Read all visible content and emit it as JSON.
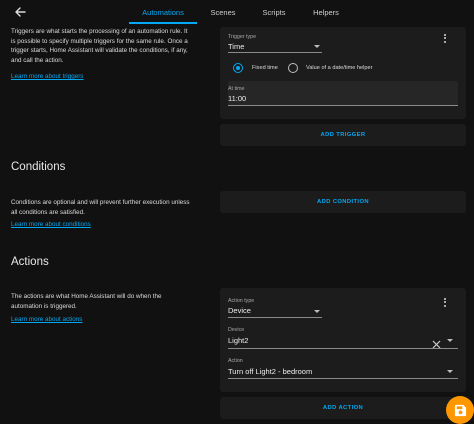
{
  "nav": {
    "tabs": [
      {
        "label": "Automations"
      },
      {
        "label": "Scenes"
      },
      {
        "label": "Scripts"
      },
      {
        "label": "Helpers"
      }
    ],
    "active_tab": "Automations"
  },
  "triggers": {
    "description_lines": [
      "Triggers are what starts the processing of an automation rule. It",
      "is possible to specify multiple triggers for the same rule. Once a",
      "trigger starts, Home Assistant will validate the conditions, if any,",
      "and call the action."
    ],
    "learn_more": "Learn more about triggers",
    "card": {
      "type_label": "Trigger type",
      "type_value": "Time",
      "radio_fixed": "Fixed time",
      "radio_helper": "Value of a date/time helper",
      "at_label": "At time",
      "at_value": "11:00"
    },
    "add_button": "ADD TRIGGER"
  },
  "conditions": {
    "title": "Conditions",
    "description_lines": [
      "Conditions are optional and will prevent further execution unless",
      "all conditions are satisfied."
    ],
    "learn_more": "Learn more about conditions",
    "add_button": "ADD CONDITION"
  },
  "actions": {
    "title": "Actions",
    "description_lines": [
      "The actions are what Home Assistant will do when the",
      "automation is triggered."
    ],
    "learn_more": "Learn more about actions",
    "card": {
      "type_label": "Action type",
      "type_value": "Device",
      "device_label": "Device",
      "device_value": "Light2",
      "action_label": "Action",
      "action_value": "Turn off Light2 - bedroom"
    },
    "add_button": "ADD ACTION"
  },
  "colors": {
    "accent": "#03a9f4",
    "fab": "#ff9800",
    "background": "#111111",
    "card": "#1c1c1c"
  }
}
